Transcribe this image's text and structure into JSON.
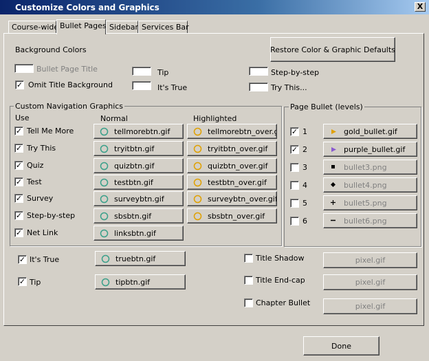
{
  "window": {
    "title": "Customize Colors and Graphics",
    "close_label": "X"
  },
  "tabs": [
    {
      "label": "Course-wide",
      "active": false
    },
    {
      "label": "Bullet Pages",
      "active": true
    },
    {
      "label": "Sidebar",
      "active": false
    },
    {
      "label": "Services Bar",
      "active": false
    }
  ],
  "restore_label": "Restore Color & Graphic Defaults",
  "background_colors": {
    "heading": "Background Colors",
    "bullet_page_title": "Bullet Page Title",
    "omit_title_background": "Omit Title Background",
    "tip": "Tip",
    "its_true": "It's True",
    "step_by_step": "Step-by-step",
    "try_this": "Try This..."
  },
  "nav_graphics": {
    "legend": "Custom Navigation Graphics",
    "col_use": "Use",
    "col_normal": "Normal",
    "col_highlighted": "Highlighted",
    "rows": [
      {
        "label": "Tell Me More",
        "checked": true,
        "normal": "tellmorebtn.gif",
        "highlighted": "tellmorebtn_over.gif"
      },
      {
        "label": "Try This",
        "checked": true,
        "normal": "tryitbtn.gif",
        "highlighted": "tryitbtn_over.gif"
      },
      {
        "label": "Quiz",
        "checked": true,
        "normal": "quizbtn.gif",
        "highlighted": "quizbtn_over.gif"
      },
      {
        "label": "Test",
        "checked": true,
        "normal": "testbtn.gif",
        "highlighted": "testbtn_over.gif"
      },
      {
        "label": "Survey",
        "checked": true,
        "normal": "surveybtn.gif",
        "highlighted": "surveybtn_over.gif"
      },
      {
        "label": "Step-by-step",
        "checked": true,
        "normal": "sbsbtn.gif",
        "highlighted": "sbsbtn_over.gif"
      },
      {
        "label": "Net Link",
        "checked": true,
        "normal": "linksbtn.gif",
        "highlighted": ""
      }
    ]
  },
  "page_bullet": {
    "legend": "Page Bullet (levels)",
    "levels": [
      {
        "num": "1",
        "checked": true,
        "file": "gold_bullet.gif",
        "enabled": true
      },
      {
        "num": "2",
        "checked": true,
        "file": "purple_bullet.gif",
        "enabled": true
      },
      {
        "num": "3",
        "checked": false,
        "file": "bullet3.png",
        "enabled": false
      },
      {
        "num": "4",
        "checked": false,
        "file": "bullet4.png",
        "enabled": false
      },
      {
        "num": "5",
        "checked": false,
        "file": "bullet5.png",
        "enabled": false
      },
      {
        "num": "6",
        "checked": false,
        "file": "bullet6.png",
        "enabled": false
      }
    ]
  },
  "extras": {
    "its_true": {
      "label": "It's True",
      "checked": true,
      "file": "truebtn.gif"
    },
    "tip": {
      "label": "Tip",
      "checked": true,
      "file": "tipbtn.gif"
    },
    "title_shadow": {
      "label": "Title Shadow",
      "checked": false,
      "file": "pixel.gif"
    },
    "title_end_cap": {
      "label": "Title End-cap",
      "checked": false,
      "file": "pixel.gif"
    },
    "chapter_bullet": {
      "label": "Chapter Bullet",
      "checked": false,
      "file": "pixel.gif"
    }
  },
  "done_label": "Done",
  "colors": {
    "title_start": "#0a246a",
    "face": "#d4d0c8",
    "gold": "#e0a000",
    "purple": "#8a5ad0",
    "green_icon": "#3aa08a"
  }
}
